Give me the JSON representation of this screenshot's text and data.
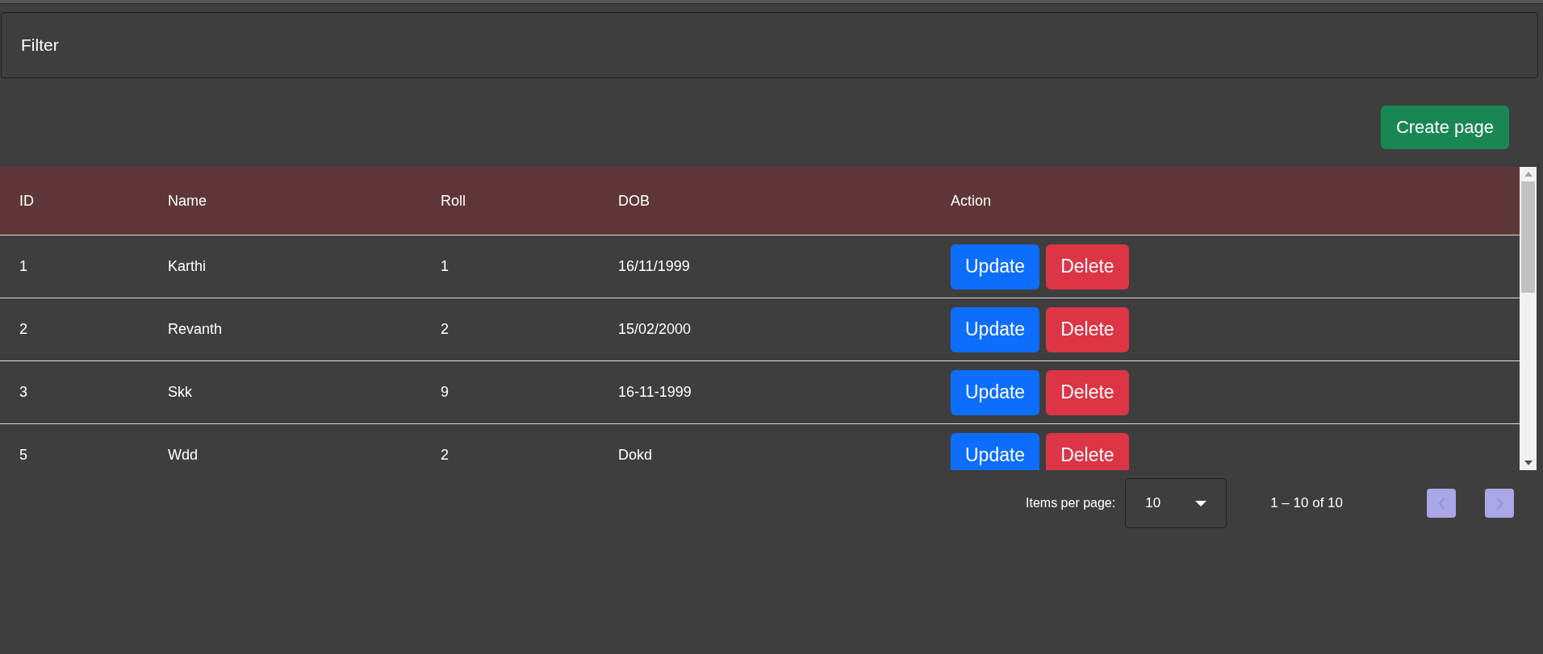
{
  "filter": {
    "title": "Filter"
  },
  "create_button": "Create page",
  "table": {
    "columns": [
      "ID",
      "Name",
      "Roll",
      "DOB",
      "Action"
    ],
    "rows": [
      {
        "cells": [
          "1",
          "Karthi",
          "1",
          "16/11/1999"
        ],
        "actions": [
          "Update",
          "Delete"
        ]
      },
      {
        "cells": [
          "2",
          "Revanth",
          "2",
          "15/02/2000"
        ],
        "actions": [
          "Update",
          "Delete"
        ]
      },
      {
        "cells": [
          "3",
          "Skk",
          "9",
          "16-11-1999"
        ],
        "actions": [
          "Update",
          "Delete"
        ]
      },
      {
        "cells": [
          "5",
          "Wdd",
          "2",
          "Dokd"
        ],
        "actions": [
          "Update",
          "Delete"
        ]
      }
    ]
  },
  "paginator": {
    "label": "Items per page:",
    "page_size": "10",
    "range": "1 – 10 of 10",
    "previous_disabled": true,
    "next_disabled": true
  }
}
